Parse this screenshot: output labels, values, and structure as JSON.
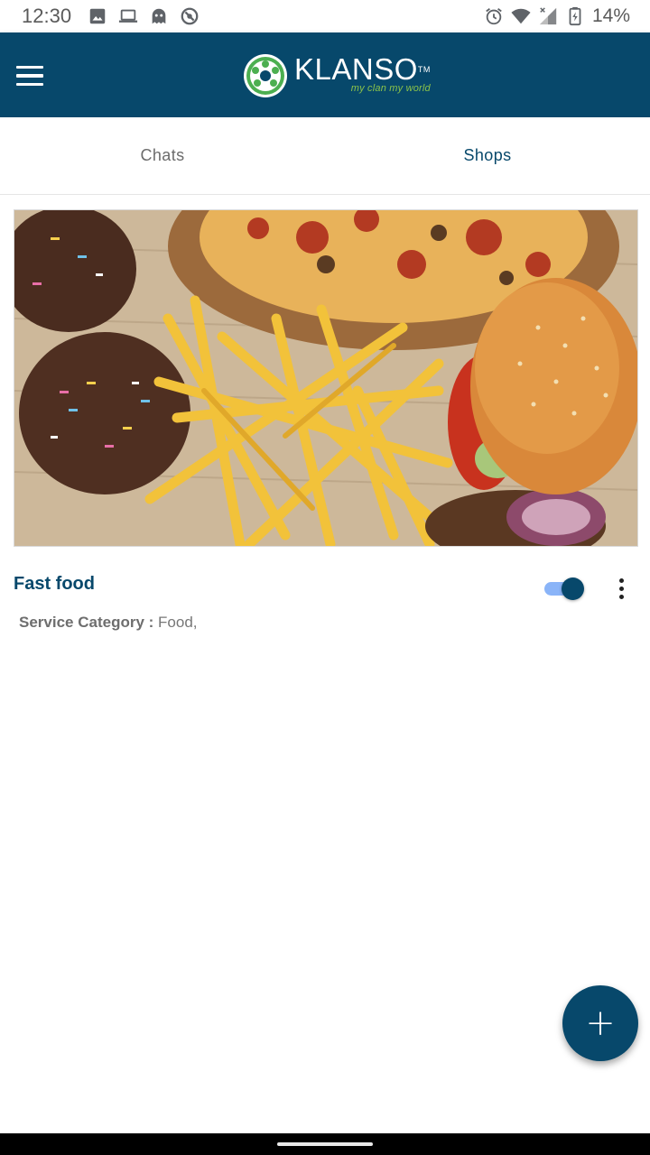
{
  "status_bar": {
    "time": "12:30",
    "battery_percent": "14%",
    "left_icons": [
      "image-icon",
      "laptop-icon",
      "ghost-icon",
      "do-not-disturb-icon"
    ],
    "right_icons": [
      "alarm-icon",
      "wifi-icon",
      "signal-icon",
      "battery-icon"
    ]
  },
  "app_bar": {
    "brand_name": "KLANSO",
    "trademark": "TM",
    "tagline": "my clan my world",
    "color": "#07486b"
  },
  "tabs": [
    {
      "label": "Chats",
      "selected": false
    },
    {
      "label": "Shops",
      "selected": true
    }
  ],
  "shop": {
    "title": "Fast food",
    "category_label": "Service Category :",
    "category_value": "Food,",
    "enabled": true
  },
  "colors": {
    "primary": "#07486b",
    "toggle_track": "#8ab4f8",
    "logo_green": "#8bc34a"
  }
}
